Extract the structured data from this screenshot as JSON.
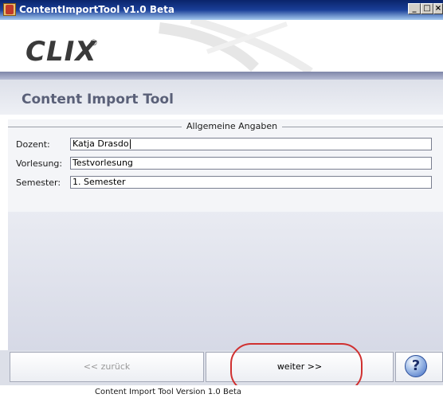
{
  "window": {
    "title": "ContentImportTool v1.0 Beta",
    "minimize_glyph": "_",
    "maximize_glyph": "□",
    "close_glyph": "×"
  },
  "header": {
    "logo_text": "CLIX",
    "logo_mark": "®",
    "page_title": "Content Import Tool"
  },
  "form": {
    "group_title": "Allgemeine Angaben",
    "fields": [
      {
        "label": "Dozent:",
        "value": "Katja Drasdo"
      },
      {
        "label": "Vorlesung:",
        "value": "Testvorlesung"
      },
      {
        "label": "Semester:",
        "value": "1. Semester"
      }
    ]
  },
  "buttons": {
    "back_label": "<< zurück",
    "next_label": "weiter >>",
    "help_glyph": "?"
  },
  "footer": {
    "version_text": "Content Import Tool Version 1.0 Beta"
  },
  "colors": {
    "title_bar": "#0a246a",
    "highlight_ring": "#d03030",
    "band_text": "#5a6078"
  }
}
